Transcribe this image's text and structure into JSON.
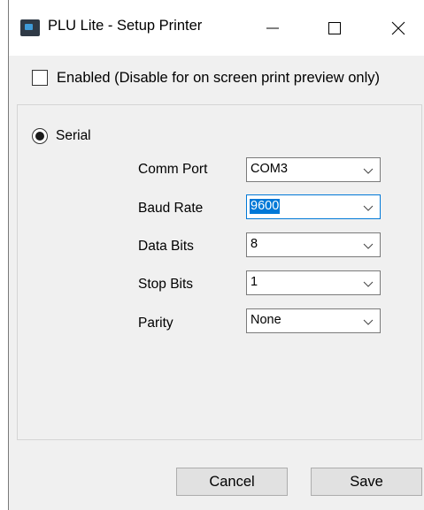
{
  "window": {
    "title": "PLU Lite - Setup Printer"
  },
  "enabled_checkbox": {
    "label": "Enabled (Disable for on screen print preview only)",
    "checked": false
  },
  "serial_radio": {
    "label": "Serial",
    "selected": true
  },
  "fields": [
    {
      "label": "Comm Port",
      "value": "COM3"
    },
    {
      "label": "Baud Rate",
      "value": "9600"
    },
    {
      "label": "Data Bits",
      "value": "8"
    },
    {
      "label": "Stop Bits",
      "value": "1"
    },
    {
      "label": "Parity",
      "value": "None"
    }
  ],
  "buttons": {
    "cancel": "Cancel",
    "save": "Save"
  },
  "colors": {
    "accent": "#0078d7",
    "dialog_bg": "#f0f0f0",
    "button_bg": "#e1e1e1"
  },
  "icons": {
    "app": "plu-lite-app-icon",
    "minimize": "minimize-icon",
    "maximize": "maximize-icon",
    "close": "close-icon",
    "dropdown": "chevron-down-icon"
  }
}
